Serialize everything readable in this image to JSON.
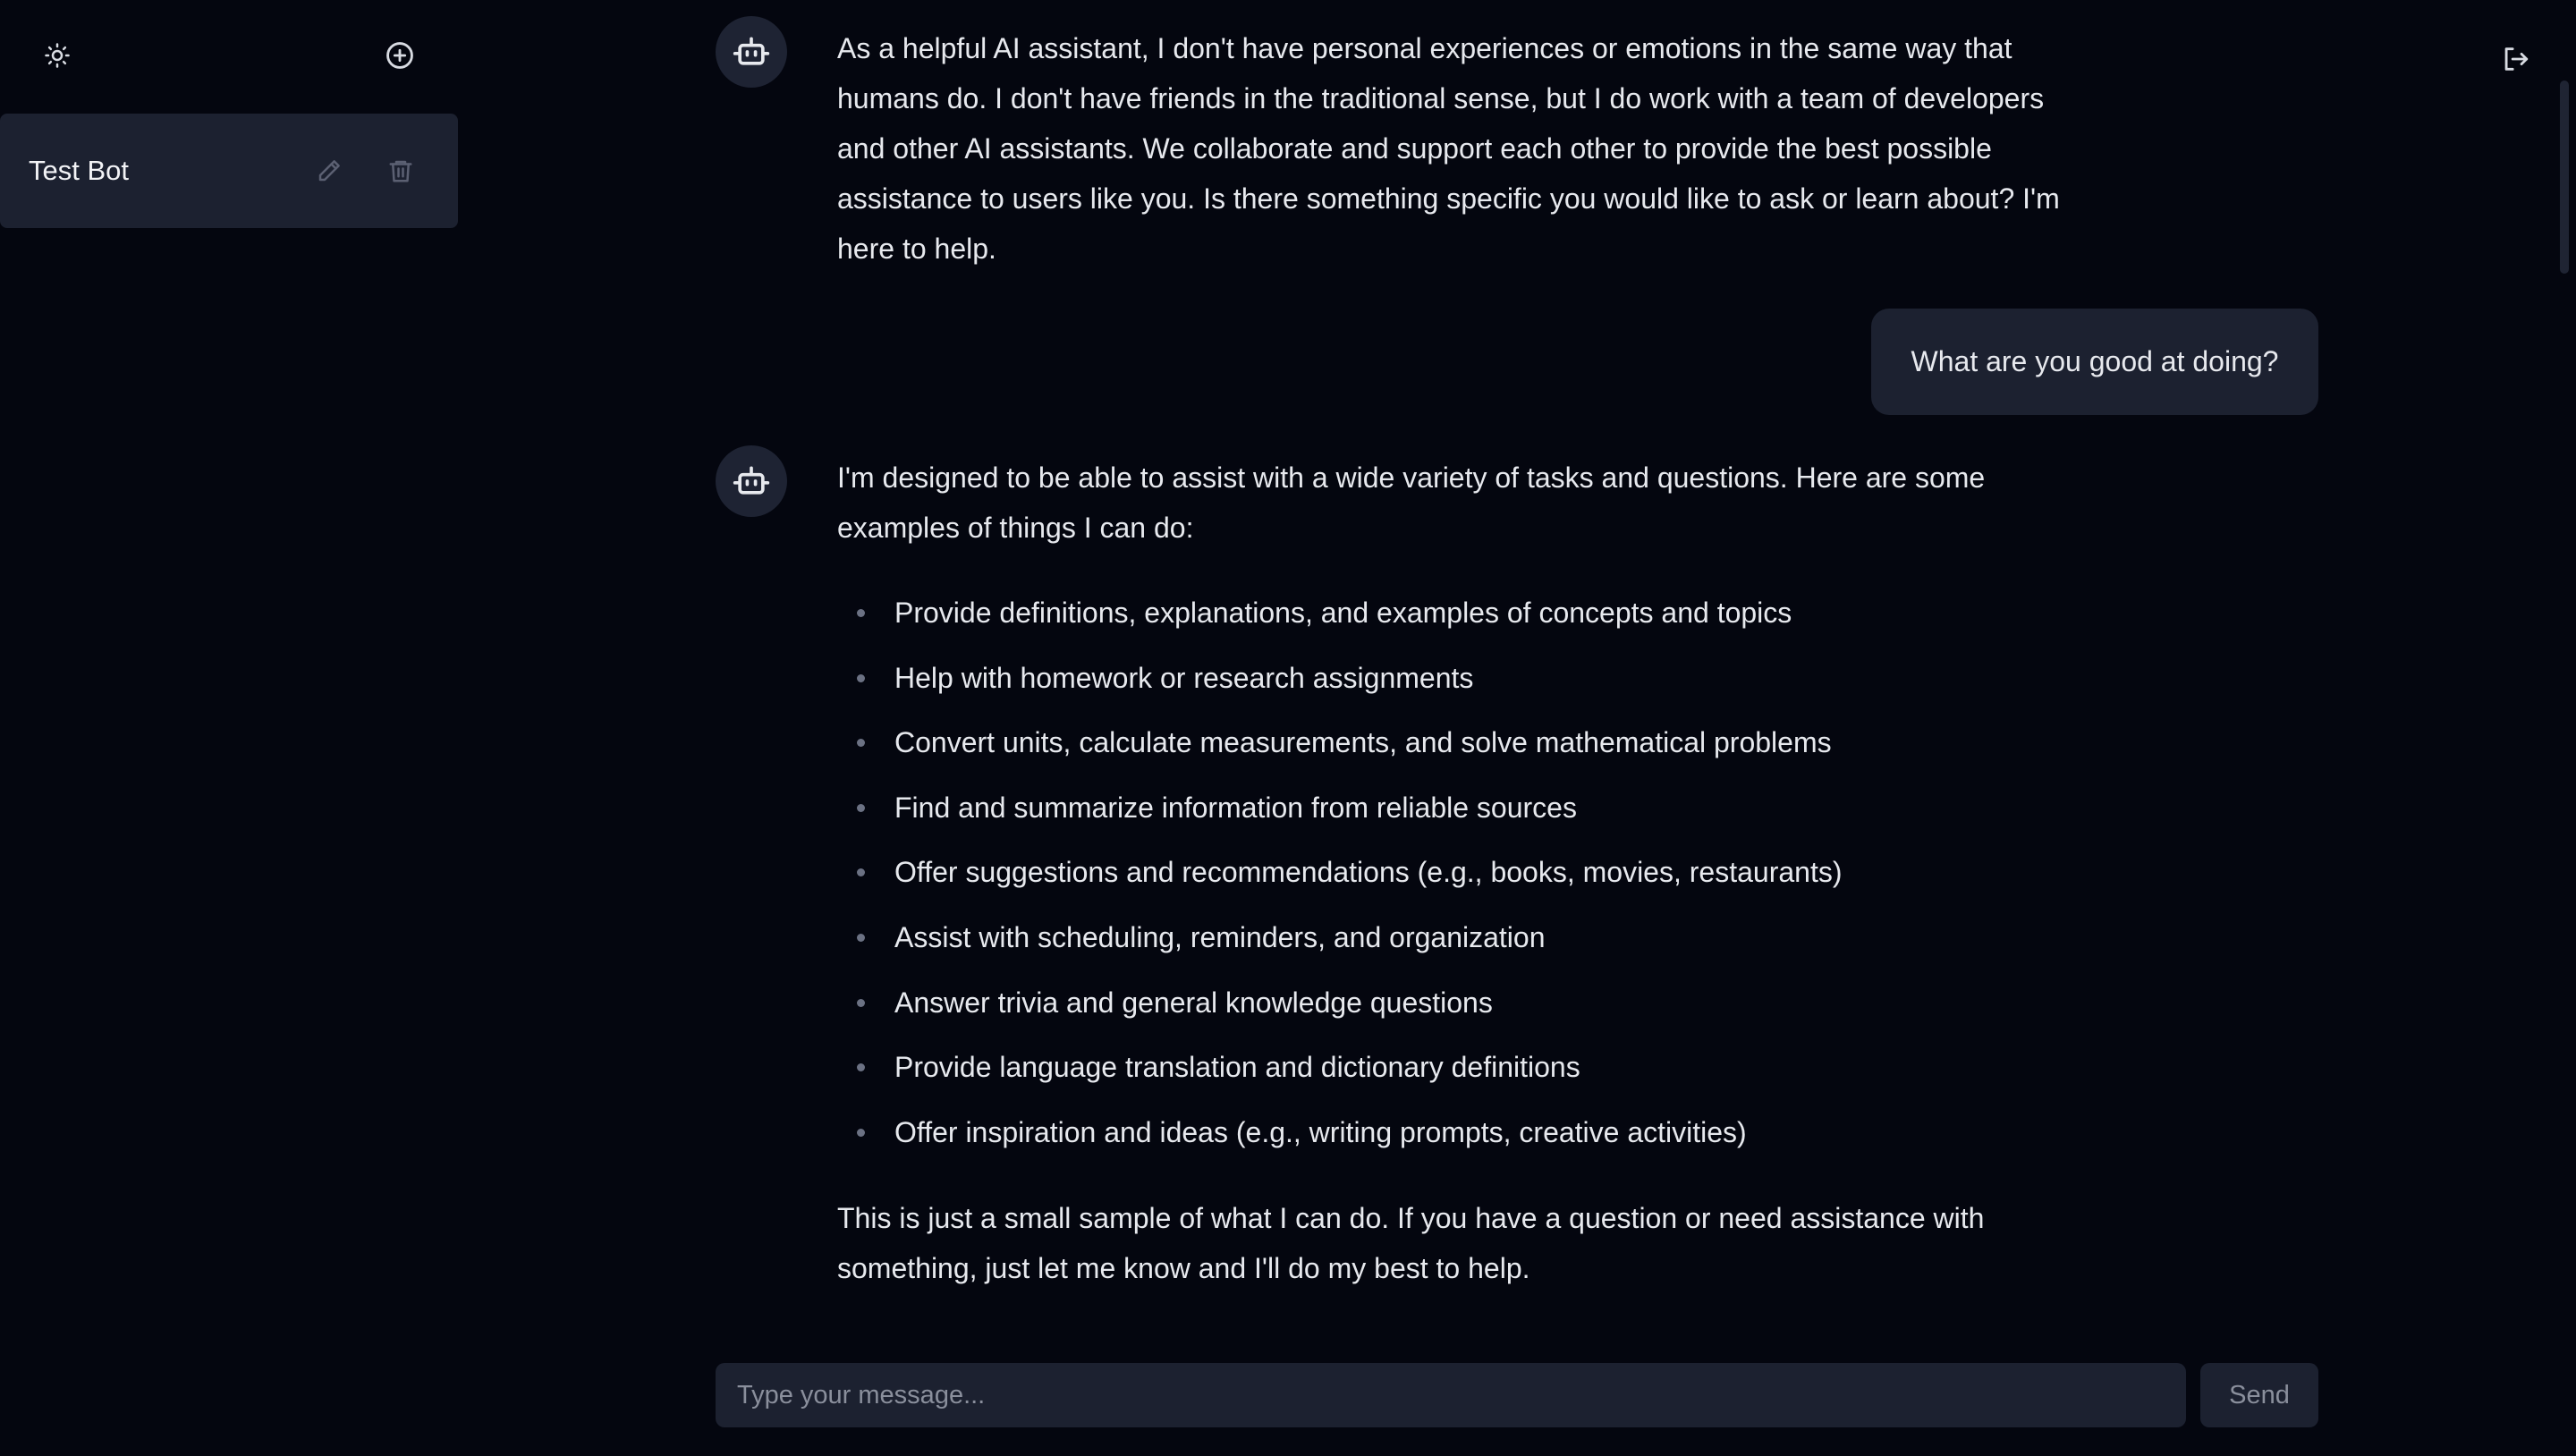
{
  "sidebar": {
    "theme_icon": "sun-icon",
    "new_chat_icon": "plus-circle-icon",
    "bots": [
      {
        "name": "Test Bot",
        "edit_icon": "pencil-icon",
        "delete_icon": "trash-icon"
      }
    ]
  },
  "header": {
    "logout_icon": "logout-icon"
  },
  "messages": [
    {
      "role": "assistant",
      "avatar_icon": "robot-icon",
      "text": "As a helpful AI assistant, I don't have personal experiences or emotions in the same way that humans do. I don't have friends in the traditional sense, but I do work with a team of developers and other AI assistants. We collaborate and support each other to provide the best possible assistance to users like you. Is there something specific you would like to ask or learn about? I'm here to help."
    },
    {
      "role": "user",
      "text": "What are you good at doing?"
    },
    {
      "role": "assistant",
      "avatar_icon": "robot-icon",
      "intro": "I'm designed to be able to assist with a wide variety of tasks and questions. Here are some examples of things I can do:",
      "items": [
        "Provide definitions, explanations, and examples of concepts and topics",
        "Help with homework or research assignments",
        "Convert units, calculate measurements, and solve mathematical problems",
        "Find and summarize information from reliable sources",
        "Offer suggestions and recommendations (e.g., books, movies, restaurants)",
        "Assist with scheduling, reminders, and organization",
        "Answer trivia and general knowledge questions",
        "Provide language translation and dictionary definitions",
        "Offer inspiration and ideas (e.g., writing prompts, creative activities)"
      ],
      "outro": "This is just a small sample of what I can do. If you have a question or need assistance with something, just let me know and I'll do my best to help."
    }
  ],
  "composer": {
    "placeholder": "Type your message...",
    "value": "",
    "send_label": "Send"
  },
  "colors": {
    "background": "#04060f",
    "surface": "#1c2130",
    "text": "#e7e9ee",
    "muted": "#8a8f9c"
  }
}
